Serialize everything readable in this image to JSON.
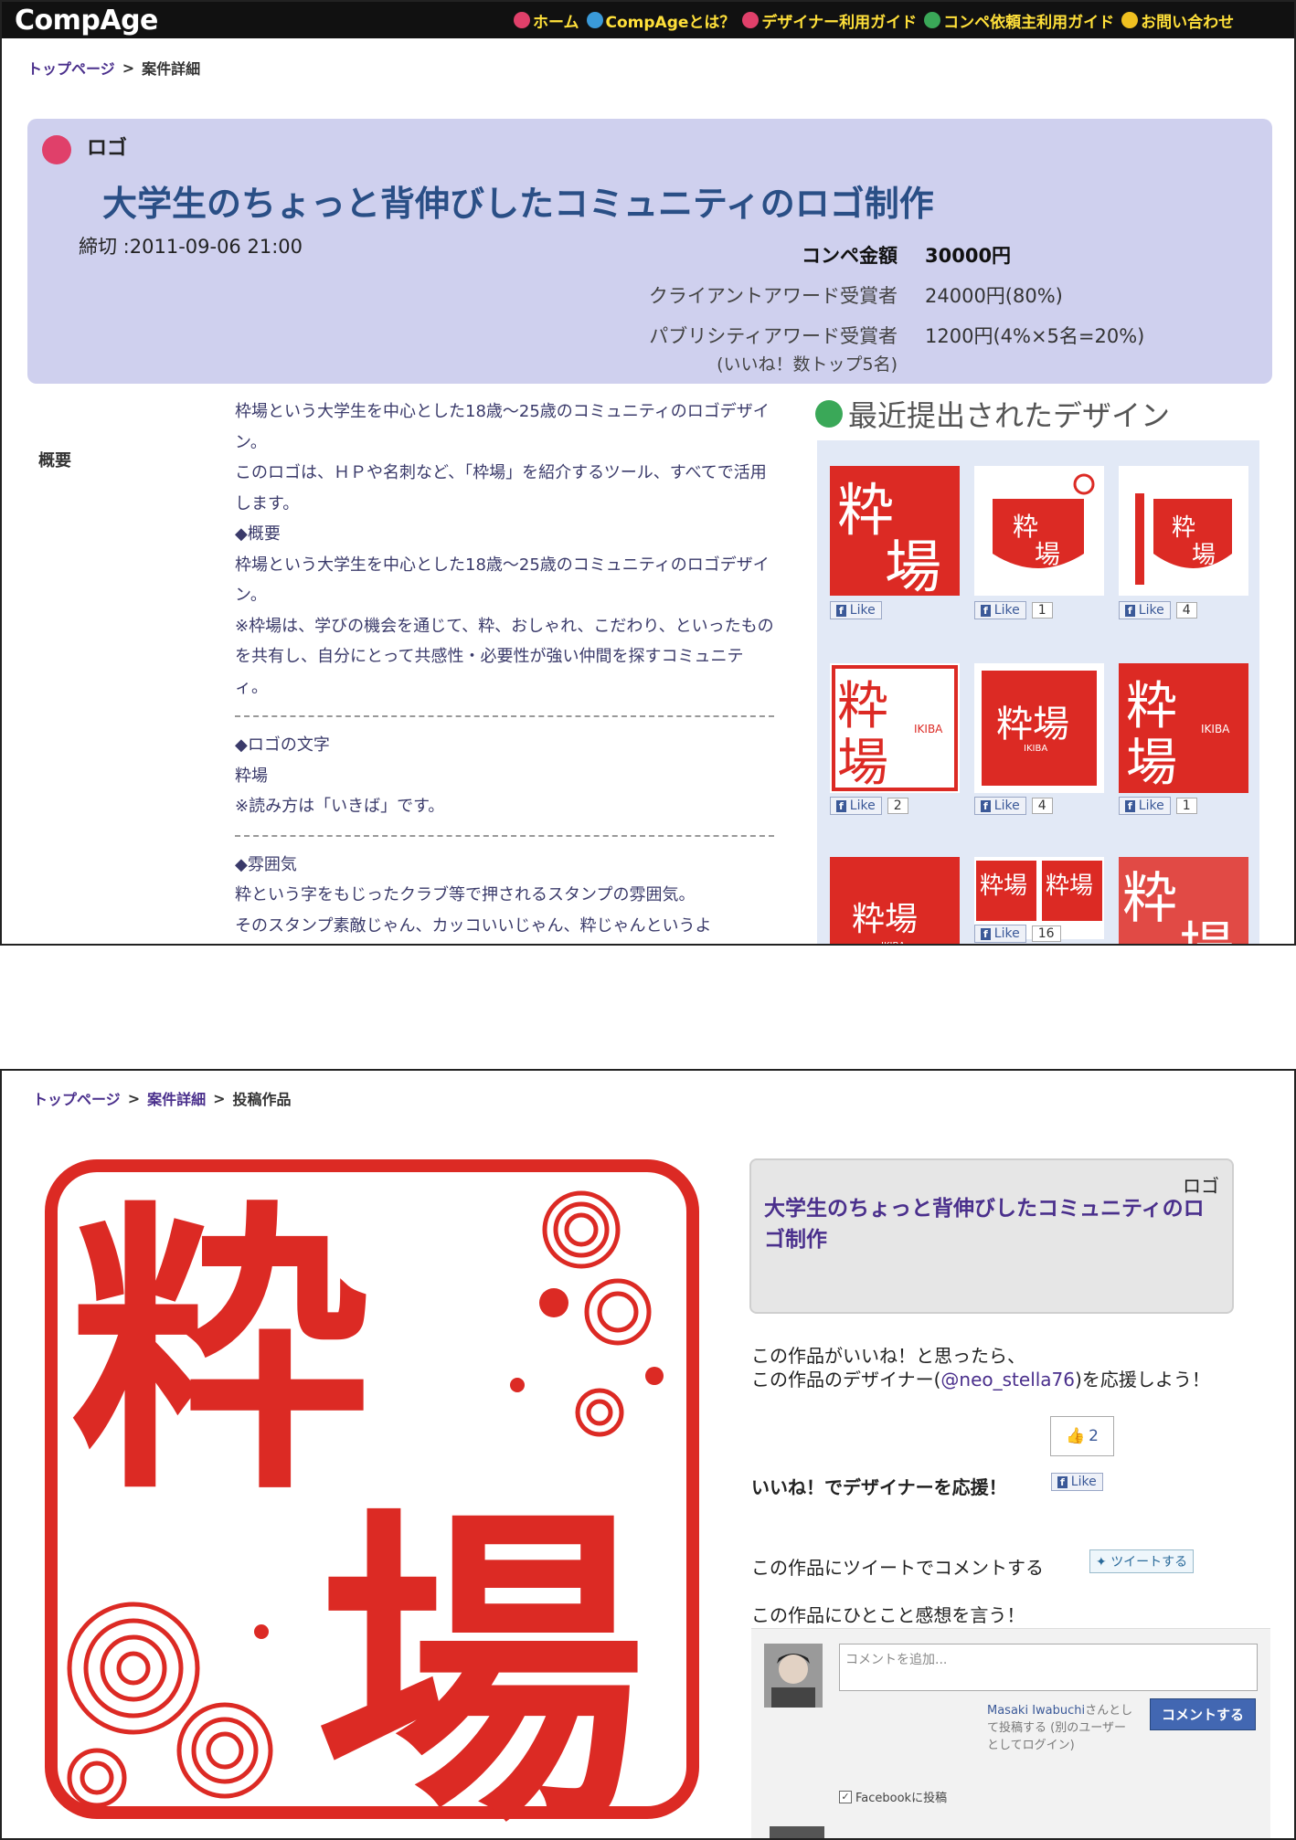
{
  "nav": {
    "logo": "CompAge",
    "links": [
      {
        "label": "ホーム",
        "color": "#e0406a"
      },
      {
        "label": "CompAgeとは？",
        "color": "#3a9ad9"
      },
      {
        "label": "デザイナー利用ガイド",
        "color": "#e0406a"
      },
      {
        "label": "コンペ依頼主利用ガイド",
        "color": "#3aa858"
      },
      {
        "label": "お問い合わせ",
        "color": "#f0c020"
      }
    ]
  },
  "detail": {
    "breadcrumb": {
      "top": "トップページ",
      "sep": ">",
      "current": "案件詳細"
    },
    "category": "ロゴ",
    "title": "大学生のちょっと背伸びしたコミュニティのロゴ制作",
    "deadline": "締切 :2011-09-06 21:00",
    "prizes": [
      {
        "label": "コンペ金額",
        "value": "30000円"
      },
      {
        "label": "クライアントアワード受賞者",
        "value": "24000円(80%)"
      },
      {
        "label": "パブリシティアワード受賞者",
        "sublabel": "(いいね！数トップ5名)",
        "value": "1200円(4%×5名=20%)"
      }
    ],
    "summary_label": "概要",
    "description": {
      "lines1": [
        "枠場という大学生を中心とした18歳～25歳のコミュニティのロゴデザイン。",
        "このロゴは、ＨＰや名刺など、「枠場」を紹介するツール、すべてで活用します。",
        "◆概要",
        "枠場という大学生を中心とした18歳～25歳のコミュニティのロゴデザイン。",
        "※枠場は、学びの機会を通じて、粋、おしゃれ、こだわり、といったものを共有し、自分にとって共感性・必要性が強い仲間を探すコミュニティ。"
      ],
      "lines2": [
        "◆ロゴの文字",
        "粋場",
        "※読み方は「いきば」です。"
      ],
      "lines3": [
        "◆雰囲気",
        "粋という字をもじったクラブ等で押されるスタンプの雰囲気。",
        "そのスタンプ素敵じゃん、カッコいいじゃん、粋じゃんというよ"
      ]
    },
    "recent_heading": "最近提出されたデザイン",
    "like_label": "Like",
    "thumbs": [
      {
        "count": ""
      },
      {
        "count": "1"
      },
      {
        "count": "4"
      },
      {
        "count": "2"
      },
      {
        "count": "4"
      },
      {
        "count": "1"
      },
      {
        "count": ""
      },
      {
        "count": "16"
      },
      {
        "count": ""
      }
    ]
  },
  "work": {
    "breadcrumb": {
      "top": "トップページ",
      "sep": ">",
      "mid": "案件詳細",
      "current": "投稿作品"
    },
    "card": {
      "category": "ロゴ",
      "title": "大学生のちょっと背伸びしたコミュニティのロゴ制作"
    },
    "cheer1": "この作品がいいね！と思ったら、",
    "cheer2_pre": "この作品のデザイナー(",
    "cheer2_mention": "@neo_stella76",
    "cheer2_post": ")を応援しよう！",
    "like_count": "2",
    "like_cheer": "いいね！でデザイナーを応援！",
    "like_label": "Like",
    "tweet_text": "この作品にツイートでコメントする",
    "tweet_button": "ツイートする",
    "impression": "この作品にひとこと感想を言う！",
    "comment_placeholder": "コメントを追加...",
    "poster_name": "Masaki Iwabuchi",
    "poster_text": "さんとして投稿する (別のユーザーとしてログイン)",
    "comment_button": "コメントする",
    "fb_post": "Facebookに投稿"
  },
  "colors": {
    "accent_red": "#dc2a24",
    "title_blue": "#2a4f86",
    "panel": "#cfd0ee"
  }
}
